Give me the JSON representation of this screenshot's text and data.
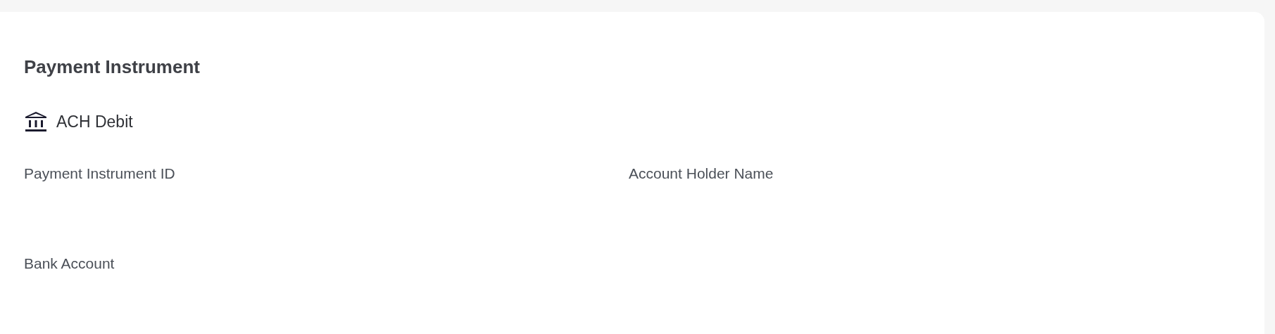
{
  "title": "Payment Instrument",
  "instrument": {
    "label": "ACH Debit"
  },
  "fields": [
    {
      "label": "Payment Instrument ID"
    },
    {
      "label": "Account Holder Name"
    },
    {
      "label": "Bank Account"
    }
  ]
}
